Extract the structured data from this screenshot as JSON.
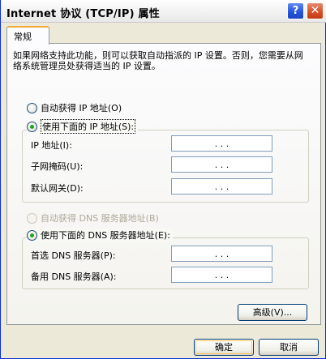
{
  "window": {
    "title": "Internet 协议 (TCP/IP) 属性",
    "help_glyph": "?",
    "close_glyph": "✕"
  },
  "tabs": [
    {
      "label": "常规"
    }
  ],
  "description": "如果网络支持此功能，则可以获取自动指派的 IP 设置。否则，您需要从网络系统管理员处获得适当的 IP 设置。",
  "ip_section": {
    "auto_option": "自动获得 IP 地址(O)",
    "manual_option": "使用下面的 IP 地址(S):",
    "fields": [
      {
        "label": "IP 地址(I):",
        "value": ". . ."
      },
      {
        "label": "子网掩码(U):",
        "value": ". . ."
      },
      {
        "label": "默认网关(D):",
        "value": ". . ."
      }
    ]
  },
  "dns_section": {
    "auto_option": "自动获得 DNS 服务器地址(B)",
    "manual_option": "使用下面的 DNS 服务器地址(E):",
    "fields": [
      {
        "label": "首选 DNS 服务器(P):",
        "value": ". . ."
      },
      {
        "label": "备用 DNS 服务器(A):",
        "value": ". . ."
      }
    ]
  },
  "buttons": {
    "advanced": "高级(V)...",
    "ok": "确定",
    "cancel": "取消"
  },
  "colors": {
    "title_border": "#0831d9",
    "tab_accent": "#f1a93a",
    "radio_dot": "#21a121"
  }
}
